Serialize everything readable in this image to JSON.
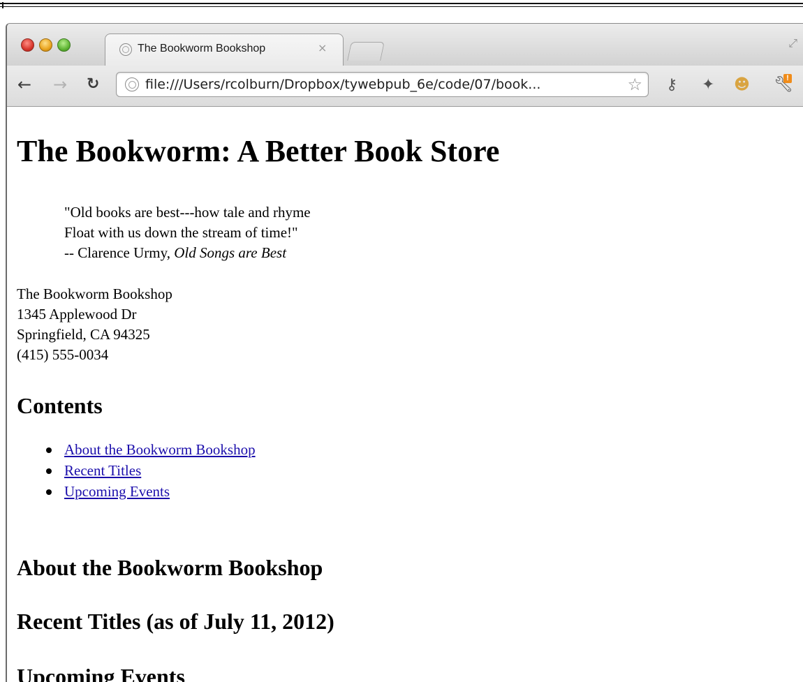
{
  "browser": {
    "tab": {
      "title": "The Bookworm Bookshop",
      "close_glyph": "×"
    },
    "address_bar": {
      "url": "file:///Users/rcolburn/Dropbox/tywebpub_6e/code/07/book..."
    },
    "toolbar_icons": [
      "back-icon",
      "forward-icon",
      "reload-icon",
      "bookmark-star-icon",
      "key-icon",
      "pin-icon",
      "extension-icon",
      "wrench-icon"
    ],
    "colors": {
      "link": "#1a0dab",
      "traffic_red": "#d8362c",
      "traffic_yellow": "#e9a41e",
      "traffic_green": "#5fb534",
      "wrench_badge": "#f08c1a"
    }
  },
  "page": {
    "title": "The Bookworm: A Better Book Store",
    "quote": {
      "line1": "\"Old books are best---how tale and rhyme",
      "line2": "Float with us down the stream of time!\"",
      "attribution_prefix": "-- Clarence Urmy, ",
      "work_title": "Old Songs are Best"
    },
    "address": {
      "name": "The Bookworm Bookshop",
      "street": "1345 Applewood Dr",
      "city": "Springfield, CA 94325",
      "phone": "(415) 555-0034"
    },
    "contents": {
      "heading": "Contents",
      "items": [
        {
          "label": "About the Bookworm Bookshop"
        },
        {
          "label": "Recent Titles"
        },
        {
          "label": "Upcoming Events"
        }
      ]
    },
    "sections": {
      "about": "About the Bookworm Bookshop",
      "recent": "Recent Titles (as of July 11, 2012)",
      "events": "Upcoming Events"
    }
  }
}
